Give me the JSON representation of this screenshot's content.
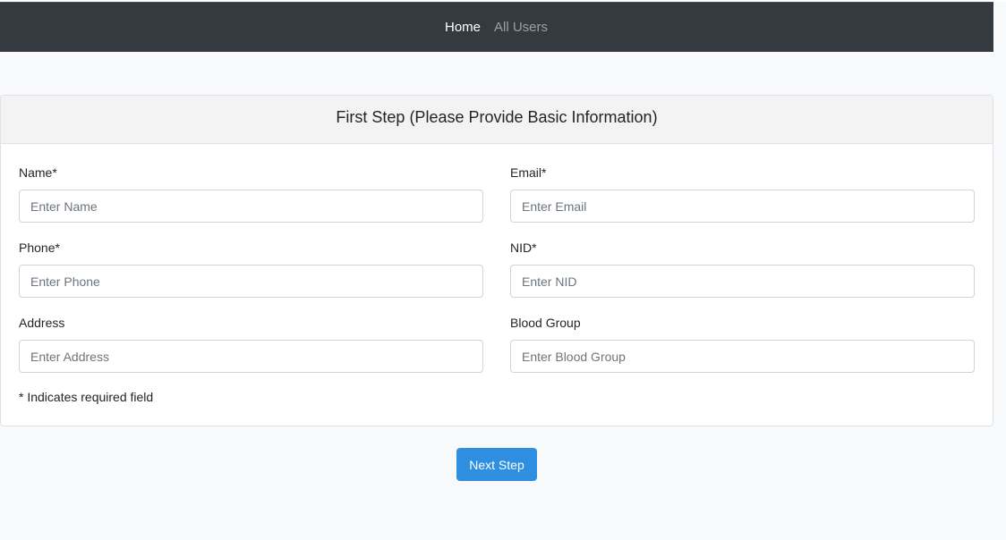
{
  "navbar": {
    "links": [
      {
        "label": "Home"
      },
      {
        "label": "All Users"
      }
    ]
  },
  "form": {
    "title": "First Step (Please Provide Basic Information)",
    "fields": {
      "name": {
        "label": "Name*",
        "placeholder": "Enter Name"
      },
      "email": {
        "label": "Email*",
        "placeholder": "Enter Email"
      },
      "phone": {
        "label": "Phone*",
        "placeholder": "Enter Phone"
      },
      "nid": {
        "label": "NID*",
        "placeholder": "Enter NID"
      },
      "address": {
        "label": "Address",
        "placeholder": "Enter Address"
      },
      "blood_group": {
        "label": "Blood Group",
        "placeholder": "Enter Blood Group"
      }
    },
    "required_note": "* Indicates required field"
  },
  "actions": {
    "next_label": "Next Step"
  },
  "colors": {
    "navbar_bg": "#343a40",
    "primary": "#2e8fe0",
    "page_bg": "#f8f9fa"
  }
}
